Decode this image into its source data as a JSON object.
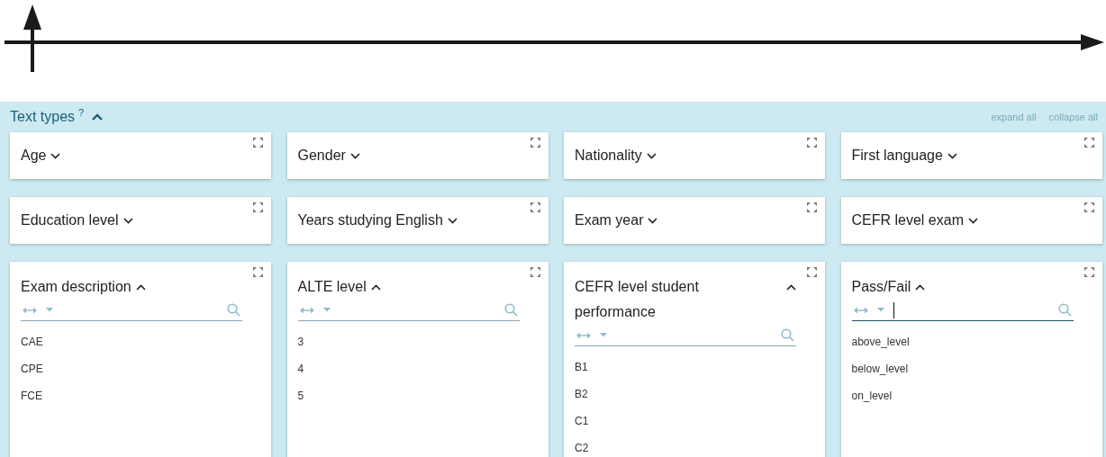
{
  "section": {
    "title": "Text types",
    "help": "?",
    "expanded": true,
    "links": [
      "expand all",
      "collapse all"
    ]
  },
  "cards": [
    {
      "title": "Age",
      "expanded": false
    },
    {
      "title": "Gender",
      "expanded": false
    },
    {
      "title": "Nationality",
      "expanded": false
    },
    {
      "title": "First language",
      "expanded": false
    },
    {
      "title": "Education level",
      "expanded": false
    },
    {
      "title": "Years studying English",
      "expanded": false
    },
    {
      "title": "Exam year",
      "expanded": false
    },
    {
      "title": "CEFR level exam",
      "expanded": false
    },
    {
      "title": "Exam description",
      "expanded": true,
      "focused": false,
      "values": [
        "CAE",
        "CPE",
        "FCE"
      ]
    },
    {
      "title": "ALTE level",
      "expanded": true,
      "focused": false,
      "values": [
        "3",
        "4",
        "5"
      ]
    },
    {
      "title": "CEFR level student performance",
      "expanded": true,
      "focused": false,
      "values": [
        "B1",
        "B2",
        "C1",
        "C2"
      ]
    },
    {
      "title": "Pass/Fail",
      "expanded": true,
      "focused": true,
      "values": [
        "above_level",
        "below_level",
        "on_level"
      ]
    }
  ]
}
